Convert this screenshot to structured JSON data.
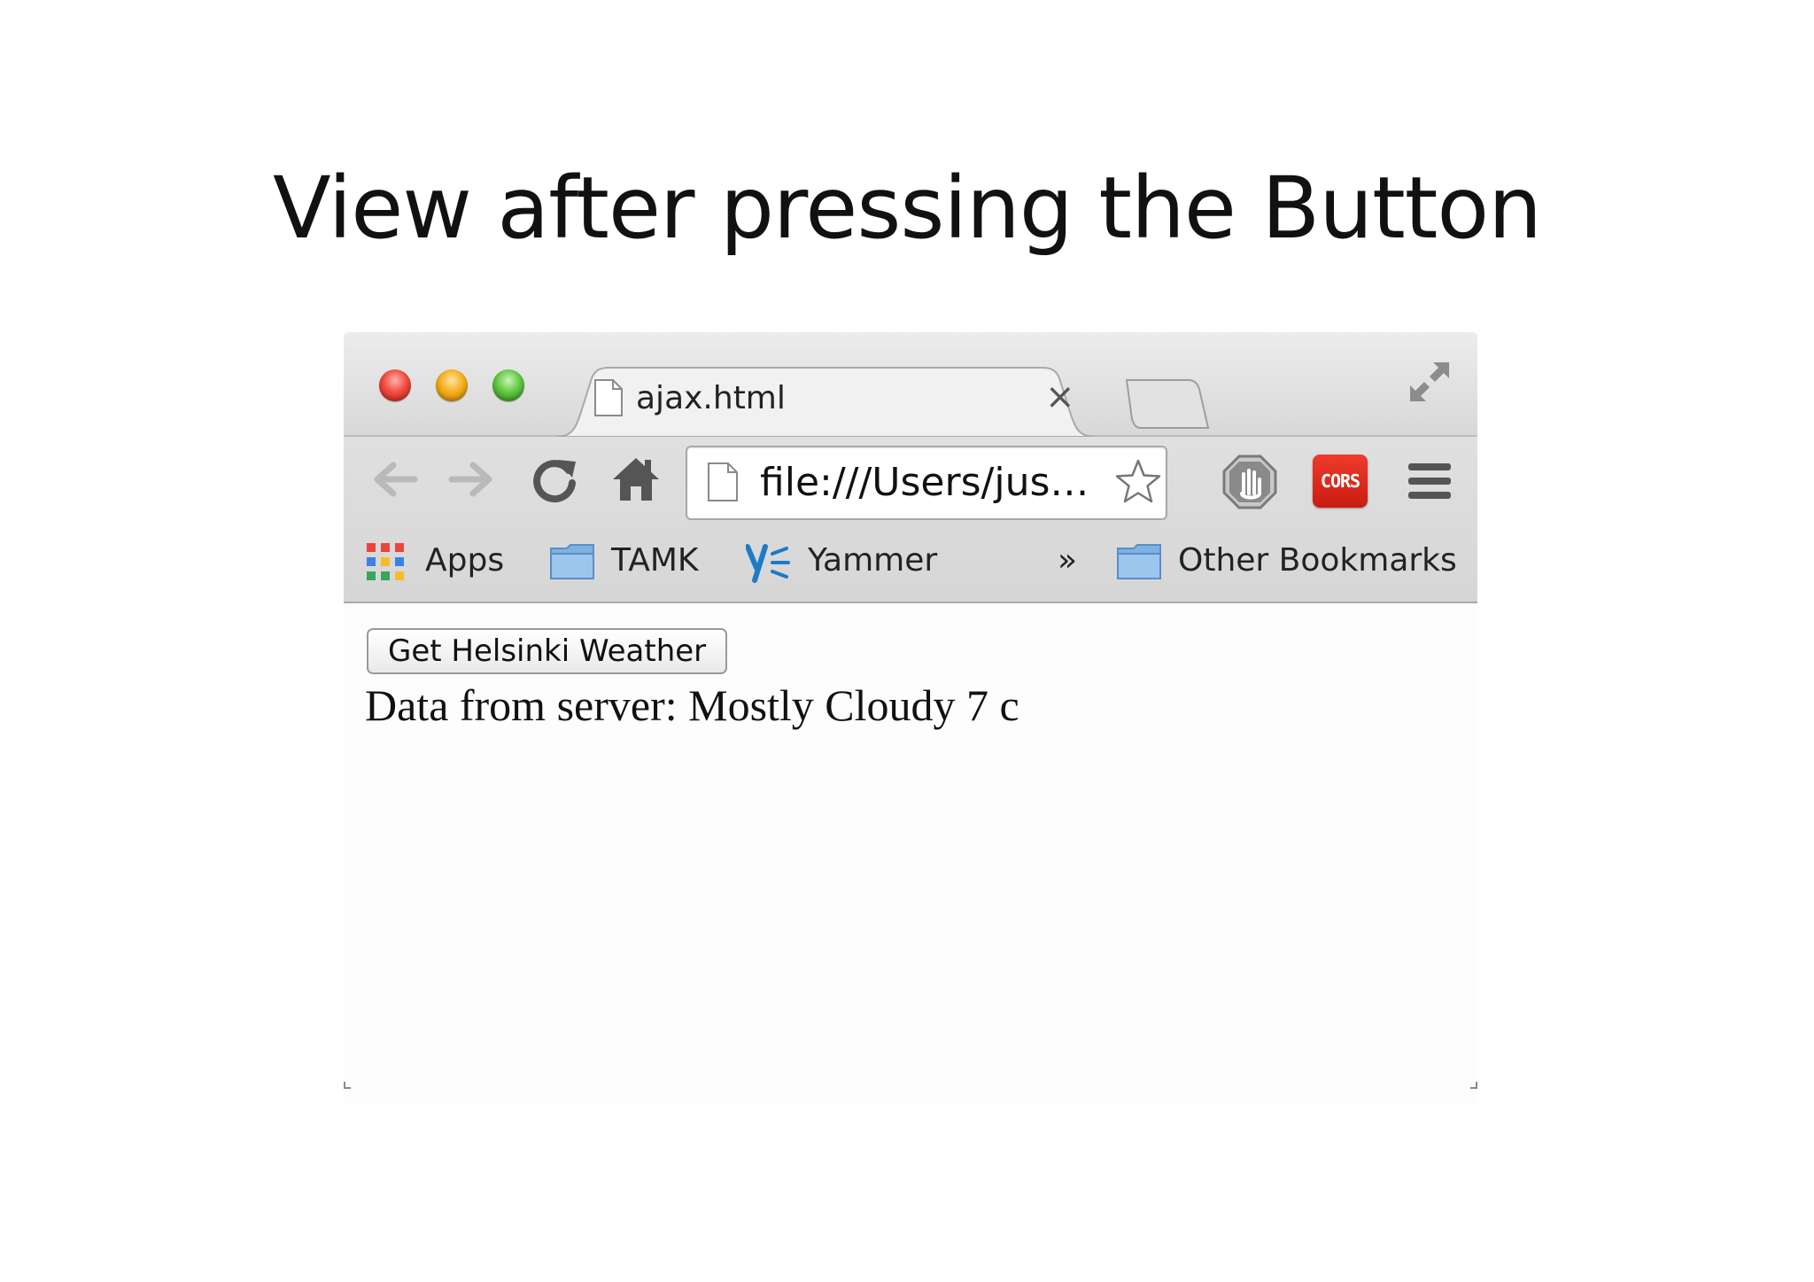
{
  "slide": {
    "title": "View after pressing the Button"
  },
  "browser": {
    "tab": {
      "title": "ajax.html",
      "close_glyph": "×"
    },
    "toolbar": {
      "address": "file:///Users/jus…",
      "cors_label": "CORS"
    },
    "bookmarks": {
      "items": [
        {
          "label": "Apps",
          "icon": "apps-grid-icon"
        },
        {
          "label": "TAMK",
          "icon": "folder-icon"
        },
        {
          "label": "Yammer",
          "icon": "yammer-icon"
        }
      ],
      "overflow_glyph": "»",
      "other": {
        "label": "Other Bookmarks",
        "icon": "folder-icon"
      }
    }
  },
  "page": {
    "button_label": "Get Helsinki Weather",
    "server_text": "Data from server: Mostly Cloudy 7 c"
  },
  "colors": {
    "close": "#f24a3e",
    "minimize": "#f5ae1c",
    "maximize": "#62c743",
    "cors": "#d8261a",
    "yammer": "#1e7ac6",
    "folder": "#7fb2e3"
  }
}
